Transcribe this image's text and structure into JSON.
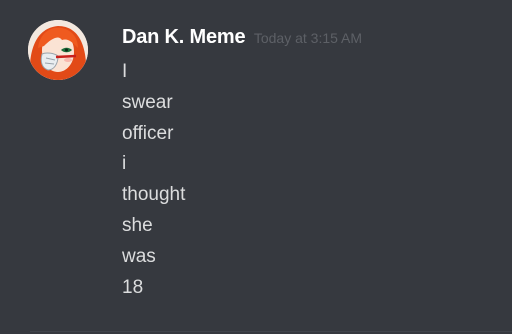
{
  "message": {
    "author": "Dan K. Meme",
    "timestamp": "Today at 3:15 AM",
    "lines": [
      "I",
      "swear",
      "officer",
      "i",
      "thought",
      "she",
      "was",
      "18"
    ]
  },
  "colors": {
    "background": "#36393f",
    "username": "#ffffff",
    "timestamp": "#5d6066",
    "message_text": "#dcddde",
    "avatar_hair": "#e8541c"
  },
  "icons": {
    "avatar": "anime-girl-avatar"
  }
}
